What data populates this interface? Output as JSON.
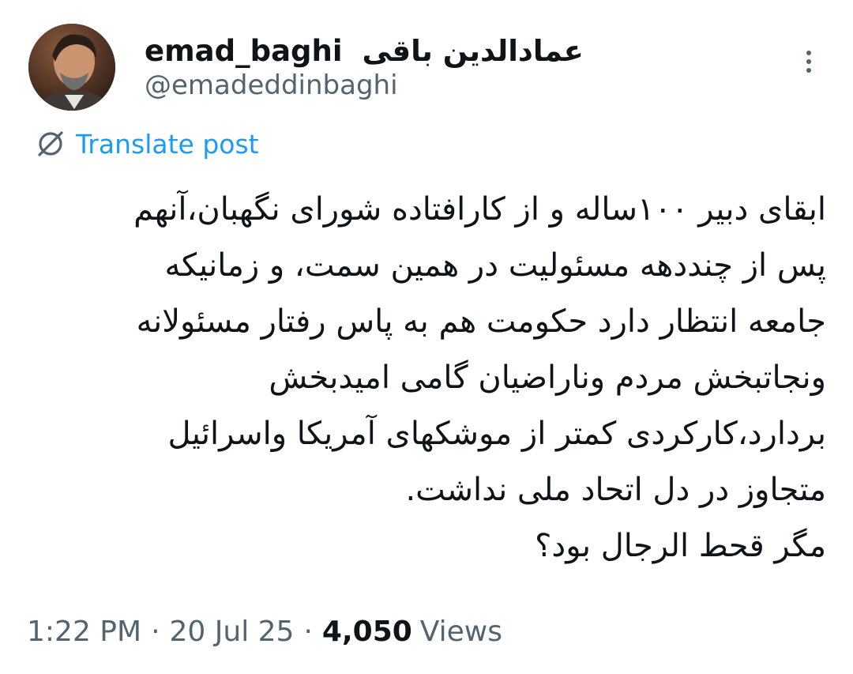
{
  "author": {
    "display_name_latin": "emad_baghi",
    "display_name_persian": "عمادالدین باقی",
    "handle": "@emadeddinbaghi"
  },
  "translate": {
    "label": "Translate post"
  },
  "tweet": {
    "lines": [
      "ابقای دبیر ۱۰۰ساله و از کارافتاده شورای نگهبان،آنهم",
      "پس از چنددهه مسئولیت در همین سمت، و زمانیکه",
      "جامعه انتظار دارد حکومت هم به پاس رفتار مسئولانه",
      "ونجاتبخش مردم وناراضیان گامی امیدبخش",
      "بردارد،کارکردی کمتر از موشکهای آمریکا واسرائیل",
      "متجاوز در دل اتحاد ملی نداشت.",
      "مگر قحط الرجال بود؟"
    ]
  },
  "meta": {
    "time": "1:22 PM",
    "date": "20 Jul 25",
    "views_count": "4,050",
    "views_label": "Views",
    "separator": "·"
  },
  "colors": {
    "text": "#0f1419",
    "secondary": "#536471",
    "link": "#1d9bf0"
  },
  "icons": {
    "more": "more-vertical-icon",
    "translate": "translate-globe-icon"
  }
}
